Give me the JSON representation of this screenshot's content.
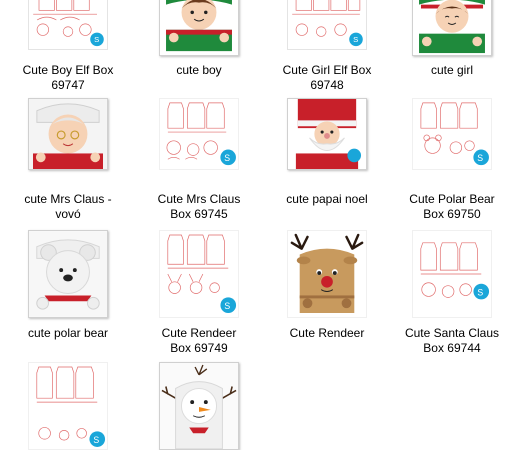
{
  "files": [
    {
      "line1": "Cute Boy Elf Box",
      "line2": "69747",
      "icon": "pattern-thumbnail-icon"
    },
    {
      "line1": "cute boy",
      "line2": "",
      "icon": "boy-elf-box-photo-icon"
    },
    {
      "line1": "Cute Girl Elf Box",
      "line2": "69748",
      "icon": "pattern-thumbnail-icon"
    },
    {
      "line1": "cute girl",
      "line2": "",
      "icon": "girl-elf-box-photo-icon"
    },
    {
      "line1": "cute Mrs Claus -",
      "line2": "vovó",
      "icon": "mrs-claus-box-photo-icon"
    },
    {
      "line1": "Cute Mrs Claus",
      "line2": "Box 69745",
      "icon": "pattern-thumbnail-icon"
    },
    {
      "line1": "cute papai noel",
      "line2": "",
      "icon": "santa-box-photo-icon"
    },
    {
      "line1": "Cute Polar Bear",
      "line2": "Box 69750",
      "icon": "pattern-thumbnail-icon"
    },
    {
      "line1": "cute polar bear",
      "line2": "",
      "icon": "polar-bear-box-photo-icon"
    },
    {
      "line1": "Cute Rendeer",
      "line2": "Box 69749",
      "icon": "pattern-thumbnail-icon"
    },
    {
      "line1": "Cute Rendeer",
      "line2": "",
      "icon": "reindeer-box-photo-icon"
    },
    {
      "line1": "Cute Santa Claus",
      "line2": "Box 69744",
      "icon": "pattern-thumbnail-icon"
    },
    {
      "line1": "",
      "line2": "",
      "icon": "pattern-thumbnail-icon"
    },
    {
      "line1": "",
      "line2": "",
      "icon": "snowman-box-photo-icon"
    }
  ],
  "colors": {
    "pattern_line": "#e06a6a",
    "silhouette_badge": "#1aa6d9",
    "elf_green": "#1f8a3c",
    "santa_red": "#c8202a",
    "reindeer_tan": "#c89a5e"
  }
}
